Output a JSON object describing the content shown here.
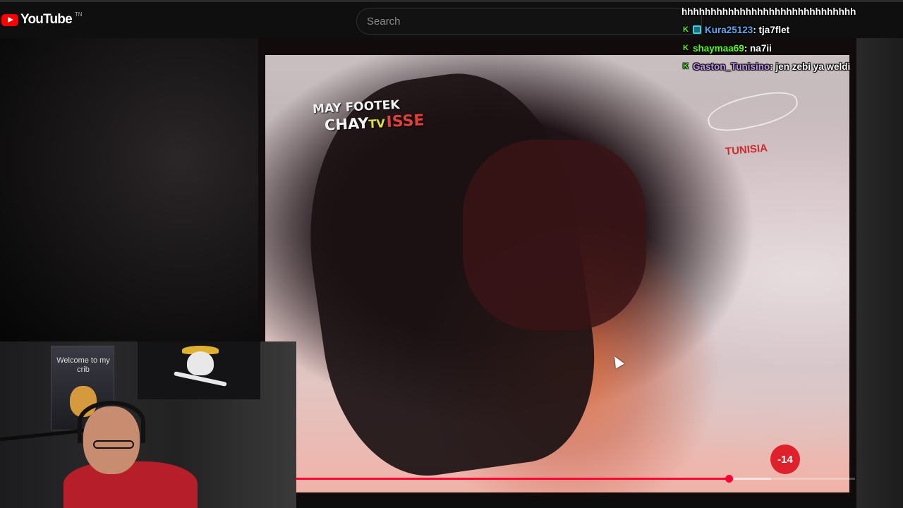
{
  "header": {
    "logo_text": "YouTube",
    "logo_tm": "TN",
    "search_placeholder": "Search"
  },
  "video": {
    "watermark_line1": "MAY FOOTEK",
    "watermark_line2_a": "CHAY",
    "watermark_line2_tv": "TV",
    "watermark_line2_b": "ISSE",
    "channel_text": "TUNISIA",
    "age_badge": "-14",
    "progress": {
      "played": 0.774,
      "buffered": 0.85,
      "color": "#ff0033"
    }
  },
  "webcam": {
    "poster_text": "Welcome to my crib"
  },
  "chat": {
    "messages": [
      {
        "user": "",
        "user_color": "#ffffff",
        "text": "hhhhhhhhhhhhhhhhhhhhhhhhhhhhhh",
        "badges": []
      },
      {
        "user": "Kura25123",
        "user_color": "#5fa8f4",
        "text": " : tja7flet",
        "badges": [
          "kick-icon",
          "subscriber-icon"
        ]
      },
      {
        "user": "shaymaa69",
        "user_color": "#53fc18",
        "text": " : na7ii",
        "badges": [
          "kick-icon"
        ]
      },
      {
        "user": "Gaston_Tunisino",
        "user_color": "#c497f0",
        "text": " : jen zebi ya weldi",
        "badges": [
          "kick-icon"
        ]
      }
    ]
  }
}
